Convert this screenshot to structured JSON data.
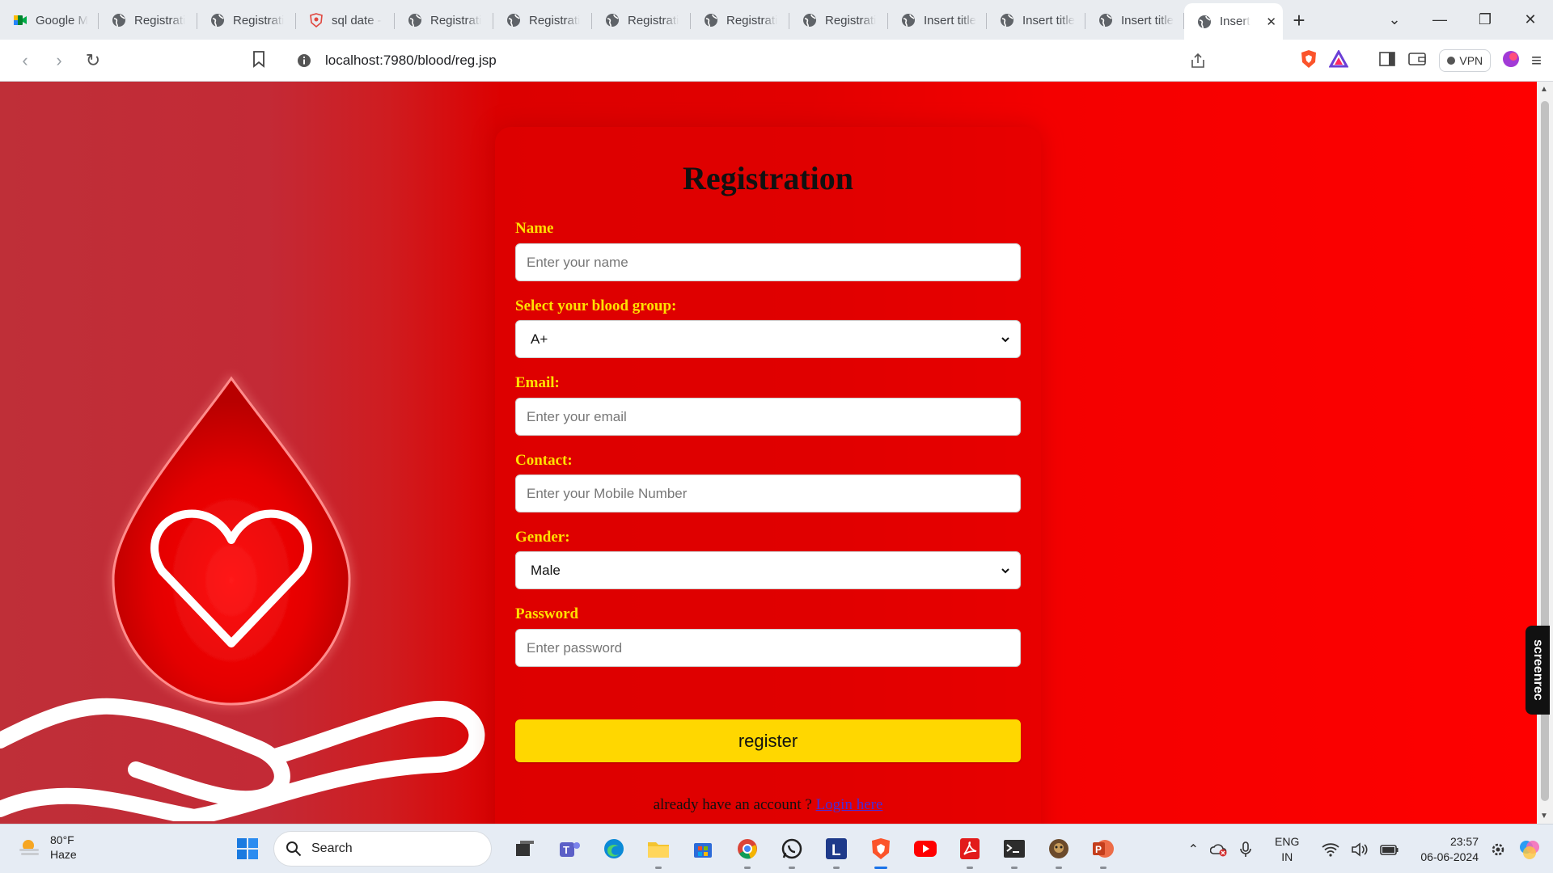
{
  "browser": {
    "tabs": [
      {
        "title": "Google M",
        "icon": "google-meet-icon",
        "active": false
      },
      {
        "title": "Registrati",
        "icon": "globe-icon",
        "active": false
      },
      {
        "title": "Registrati",
        "icon": "globe-icon",
        "active": false
      },
      {
        "title": "sql date -",
        "icon": "brave-shield-icon",
        "active": false
      },
      {
        "title": "Registrati",
        "icon": "globe-icon",
        "active": false
      },
      {
        "title": "Registrati",
        "icon": "globe-icon",
        "active": false
      },
      {
        "title": "Registrati",
        "icon": "globe-icon",
        "active": false
      },
      {
        "title": "Registrati",
        "icon": "globe-icon",
        "active": false
      },
      {
        "title": "Registrati",
        "icon": "globe-icon",
        "active": false
      },
      {
        "title": "Insert title",
        "icon": "globe-icon",
        "active": false
      },
      {
        "title": "Insert title",
        "icon": "globe-icon",
        "active": false
      },
      {
        "title": "Insert title",
        "icon": "globe-icon",
        "active": false
      },
      {
        "title": "Insert",
        "icon": "globe-icon",
        "active": true
      }
    ],
    "url": "localhost:7980/blood/reg.jsp",
    "vpn_label": "VPN"
  },
  "form": {
    "title": "Registration",
    "name_label": "Name",
    "name_placeholder": "Enter your name",
    "blood_label": "Select your blood group:",
    "blood_value": "A+",
    "email_label": "Email:",
    "email_placeholder": "Enter your email",
    "contact_label": "Contact:",
    "contact_placeholder": "Enter your Mobile Number",
    "gender_label": "Gender:",
    "gender_value": "Male",
    "password_label": "Password",
    "password_placeholder": "Enter password",
    "submit_label": "register",
    "footer_text": "already have an account ? ",
    "login_link": "Login here"
  },
  "overlay": {
    "recorder_label": "screenrec"
  },
  "taskbar": {
    "weather_temp": "80°F",
    "weather_desc": "Haze",
    "search_label": "Search",
    "lang_top": "ENG",
    "lang_bottom": "IN",
    "time": "23:57",
    "date": "06-06-2024"
  },
  "colors": {
    "label_yellow": "#ffe000",
    "button_yellow": "#ffd700",
    "page_red": "#e20000",
    "link_blue": "#4a2bd6"
  }
}
